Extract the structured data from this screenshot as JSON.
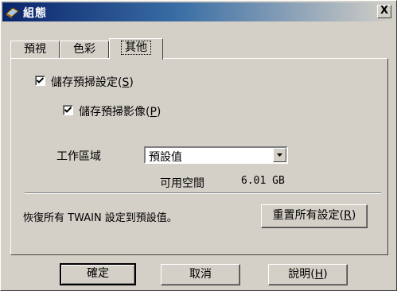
{
  "window": {
    "title": "組態",
    "close_label": "X"
  },
  "tabs": [
    {
      "label": "預視"
    },
    {
      "label": "色彩"
    },
    {
      "label": "其他"
    }
  ],
  "options": {
    "save_scan_settings": {
      "label": "儲存預掃設定(",
      "key": "S",
      "suffix": ")",
      "checked": true
    },
    "save_scan_image": {
      "label": "儲存預掃影像(",
      "key": "P",
      "suffix": ")",
      "checked": true
    }
  },
  "workspace": {
    "label": "工作區域",
    "selected": "預設值",
    "available_label": "可用空間",
    "available_value": "6.01 GB"
  },
  "reset": {
    "description": "恢復所有 TWAIN 設定到預設值。",
    "button_label": "重置所有設定(",
    "button_key": "R",
    "button_suffix": ")"
  },
  "buttons": {
    "ok": "確定",
    "cancel": "取消",
    "help_label": "說明(",
    "help_key": "H",
    "help_suffix": ")"
  },
  "icons": {
    "title_icon": "scanner-icon",
    "close_icon": "close-icon",
    "dropdown_icon": "chevron-down-icon",
    "check_icon": "check-icon"
  }
}
